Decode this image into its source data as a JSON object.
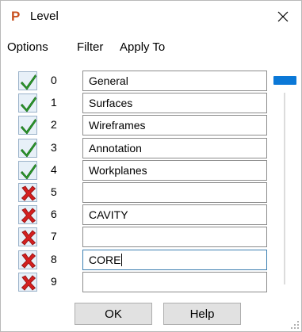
{
  "window": {
    "title": "Level",
    "app_icon_glyph": "P",
    "close_glyph": "×"
  },
  "menu": [
    "Options",
    "Filter",
    "Apply To"
  ],
  "levels": [
    {
      "number": "0",
      "name": "General",
      "enabled": true
    },
    {
      "number": "1",
      "name": "Surfaces",
      "enabled": true
    },
    {
      "number": "2",
      "name": "Wireframes",
      "enabled": true
    },
    {
      "number": "3",
      "name": "Annotation",
      "enabled": true
    },
    {
      "number": "4",
      "name": "Workplanes",
      "enabled": true
    },
    {
      "number": "5",
      "name": "",
      "enabled": false
    },
    {
      "number": "6",
      "name": "CAVITY",
      "enabled": false
    },
    {
      "number": "7",
      "name": "",
      "enabled": false
    },
    {
      "number": "8",
      "name": "CORE",
      "enabled": false,
      "focused": true
    },
    {
      "number": "9",
      "name": "",
      "enabled": false
    }
  ],
  "buttons": {
    "ok": "OK",
    "help": "Help"
  },
  "colors": {
    "accent": "#0b78d7",
    "check_green": "#2e9f2e",
    "cross_red": "#d42020",
    "app_icon": "#c8501e"
  },
  "icons": {
    "enabled": "green-check-icon",
    "disabled": "red-cross-icon",
    "close": "close-icon",
    "app": "app-logo-icon"
  }
}
